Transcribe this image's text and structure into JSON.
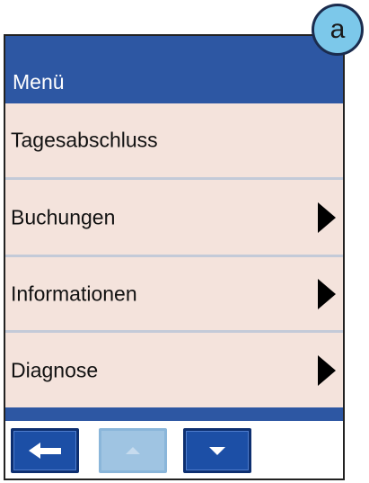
{
  "badge": {
    "label": "a"
  },
  "header": {
    "title": "Menü"
  },
  "menu": {
    "items": [
      {
        "label": "Tagesabschluss",
        "has_submenu": false
      },
      {
        "label": "Buchungen",
        "has_submenu": true
      },
      {
        "label": "Informationen",
        "has_submenu": true
      },
      {
        "label": "Diagnose",
        "has_submenu": true
      }
    ]
  },
  "toolbar": {
    "buttons": [
      {
        "icon": "arrow-left-icon",
        "enabled": true
      },
      {
        "icon": "triangle-up-icon",
        "enabled": false
      },
      {
        "icon": "triangle-down-icon",
        "enabled": true
      }
    ]
  },
  "colors": {
    "header_blue": "#2d57a3",
    "item_background": "#f4e3dc",
    "button_blue": "#1c4fa6",
    "button_disabled": "#9fc4e2",
    "badge_fill": "#7cc8ea"
  }
}
